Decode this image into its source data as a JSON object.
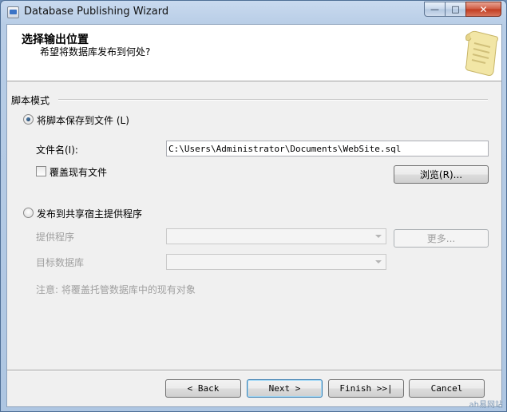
{
  "window": {
    "title": "Database Publishing Wizard",
    "minimize_glyph": "—",
    "maximize_glyph": "□",
    "close_glyph": "✕"
  },
  "header": {
    "title": "选择输出位置",
    "subtitle": "希望将数据库发布到何处?",
    "art_icon": "scroll-icon"
  },
  "section": {
    "label": "脚本模式"
  },
  "save_to_file": {
    "radio_label": "将脚本保存到文件",
    "radio_hotkey": "(L)",
    "checked": true,
    "filename_label": "文件名(I):",
    "filename_value": "C:\\Users\\Administrator\\Documents\\WebSite.sql",
    "overwrite_label": "覆盖现有文件",
    "overwrite_checked": false,
    "browse_label": "浏览(R)..."
  },
  "publish": {
    "radio_label": "发布到共享宿主提供程序",
    "checked": false,
    "provider_label": "提供程序",
    "provider_value": "",
    "more_label": "更多...",
    "target_db_label": "目标数据库",
    "target_db_value": "",
    "note": "注意: 将覆盖托管数据库中的现有对象"
  },
  "footer": {
    "back_label": "< Back",
    "next_label": "Next >",
    "finish_label": "Finish >>|",
    "cancel_label": "Cancel"
  },
  "watermark": "ah易网站"
}
